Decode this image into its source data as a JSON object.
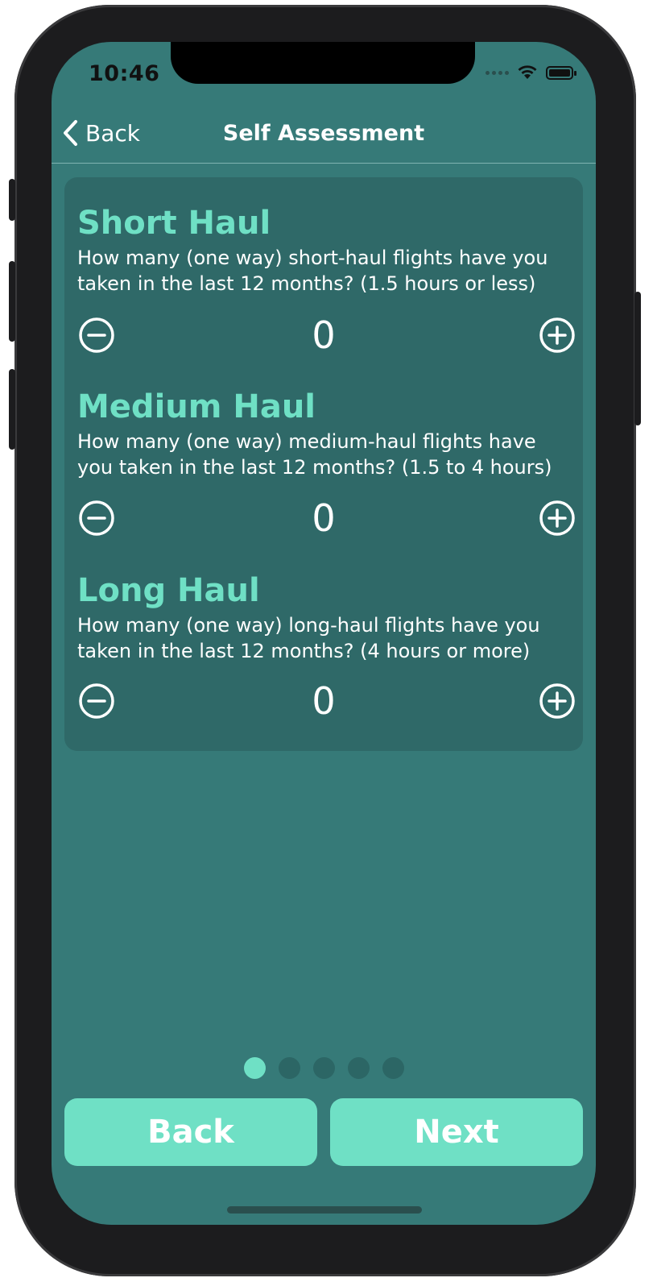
{
  "status_bar": {
    "time": "10:46"
  },
  "nav": {
    "back_label": "Back",
    "title": "Self Assessment"
  },
  "sections": [
    {
      "title": "Short Haul",
      "description": "How many (one way) short-haul flights have you taken in the last 12 months? (1.5 hours or less)",
      "value": "0"
    },
    {
      "title": "Medium Haul",
      "description": "How many (one way) medium-haul flights have you taken in the last 12 months? (1.5 to 4 hours)",
      "value": "0"
    },
    {
      "title": "Long Haul",
      "description": "How many (one way) long-haul flights have you taken in the last 12 months? (4 hours or more)",
      "value": "0"
    }
  ],
  "pager": {
    "pages": 5,
    "current": 1
  },
  "footer": {
    "back_label": "Back",
    "next_label": "Next"
  },
  "colors": {
    "background": "#367a78",
    "card": "#2f6968",
    "accent": "#6fe0c5",
    "text": "#ffffff"
  }
}
